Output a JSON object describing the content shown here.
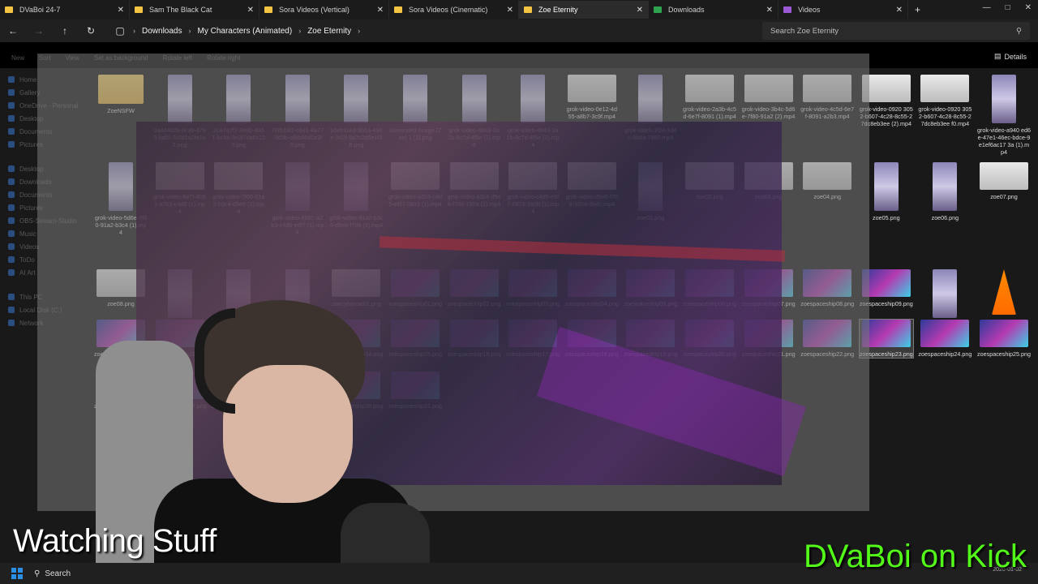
{
  "tabs": [
    {
      "label": "DVaBoi 24-7",
      "color": "#f4c542"
    },
    {
      "label": "Sam The Black Cat",
      "color": "#f4c542"
    },
    {
      "label": "Sora Videos (Vertical)",
      "color": "#f4c542"
    },
    {
      "label": "Sora Videos (Cinematic)",
      "color": "#f4c542"
    },
    {
      "label": "Zoe Eternity",
      "color": "#f4c542"
    },
    {
      "label": "Downloads",
      "color": "#2ea44f"
    },
    {
      "label": "Videos",
      "color": "#9b59d6"
    }
  ],
  "address": {
    "crumbs": [
      "Downloads",
      "My Characters (Animated)",
      "Zoe Eternity"
    ],
    "search_placeholder": "Search Zoe Eternity"
  },
  "toolbar": {
    "items": [
      "New",
      "Sort",
      "View",
      "Set as background",
      "Rotate left",
      "Rotate right"
    ],
    "details_label": "Details"
  },
  "sidebar": {
    "group1": [
      "Home",
      "Gallery",
      "OneDrive - Personal",
      "Desktop",
      "Documents",
      "Pictures"
    ],
    "group2": [
      "Desktop",
      "Downloads",
      "Documents",
      "Pictures",
      "OBS-Stream-Studio",
      "Music",
      "Videos",
      "ToDo",
      "AI Art"
    ],
    "group3": [
      "This PC",
      "Local Disk (C:)",
      "Network"
    ]
  },
  "files": {
    "row1": [
      {
        "name": "ZoeNSFW",
        "kind": "folder"
      },
      {
        "name": "0a4d4d2b-0c3b-4793-bdf0-7c0d1a2fe1a2.png",
        "kind": "portrait"
      },
      {
        "name": "2c47a7f2-3e8b-40d1-bc9a-8e3f7da6c123.png",
        "kind": "portrait"
      },
      {
        "name": "7f3b28f2-c6e1-4a77-9d3b-af8b46d1e2f0.png",
        "kind": "portrait"
      },
      {
        "name": "b0eb11e3-5b1a-4a8e-9d2f-8a7c2d5e1f38.png",
        "kind": "portrait"
      },
      {
        "name": "Generated Image (Zoe) 1 (1).png",
        "kind": "portrait"
      },
      {
        "name": "grok-video-4843-2a1b-8c7d-4f5e (1).mp4",
        "kind": "portrait"
      },
      {
        "name": "grok-video-4843-2a1b-8c7d-4f5e (2).mp4",
        "kind": "portrait"
      },
      {
        "name": "grok-video-0e12-4d55-a8b7-3c9f.mp4",
        "kind": "video"
      },
      {
        "name": "grok-video-1f2e-3d4c-5b6a-7980.mp4",
        "kind": "portrait"
      },
      {
        "name": "grok-video-2a3b-4c5d-6e7f-8091 (1).mp4",
        "kind": "video"
      },
      {
        "name": "grok-video-3b4c-5d6e-7f80-91a2 (2).mp4",
        "kind": "video"
      },
      {
        "name": "grok-video-4c5d-6e7f-8091-a2b3.mp4",
        "kind": "video"
      },
      {
        "name": "grok-video-0920 3052-b607-4c28-8c55-27dc8eb3ee (2).mp4",
        "kind": "video"
      },
      {
        "name": "grok-video-0920 3052-b607-4c28-8c55-27dc8eb3ee f0.mp4",
        "kind": "video"
      },
      {
        "name": "grok-video-a940 ed6e-47e1-46ec-bdce-9e1ef6ac17 3a (1).mp4",
        "kind": "portrait"
      }
    ],
    "row2": [
      {
        "name": "grok-video-5d6e-7f80-91a2-b3c4 (1).mp4",
        "kind": "portrait"
      },
      {
        "name": "grok-video-6e7f-8091-a2b3-c4d5 (1).mp4",
        "kind": "video"
      },
      {
        "name": "grok-video-7f80-91a2-b3c4-d5e6 (2).mp4",
        "kind": "video"
      },
      {
        "name": "grok-video-8091-a2b3-c4d5-e6f7 (1).mp4",
        "kind": "portrait"
      },
      {
        "name": "grok-video-91a2-b3c4-d5e6-f708 (3).mp4",
        "kind": "portrait"
      },
      {
        "name": "grok-video-a2b3-c4d5-e6f7-0819 (1).mp4",
        "kind": "video"
      },
      {
        "name": "grok-video-b3c4-d5e6-f708-192a (2).mp4",
        "kind": "video"
      },
      {
        "name": "grok-video-c4d5-e6f7-0819-2a3b (1).mp4",
        "kind": "video"
      },
      {
        "name": "grok-video-d5e6-f708-192a-3b4c.mp4",
        "kind": "video"
      },
      {
        "name": "zoe01.png",
        "kind": "portrait"
      },
      {
        "name": "zoe02.png",
        "kind": "video"
      },
      {
        "name": "zoe03.png",
        "kind": "video"
      },
      {
        "name": "zoe04.png",
        "kind": "video"
      },
      {
        "name": "zoe05.png",
        "kind": "portrait"
      },
      {
        "name": "zoe06.png",
        "kind": "portrait"
      },
      {
        "name": "zoe07.png",
        "kind": "video"
      }
    ],
    "row3": [
      {
        "name": "zoe08.png",
        "kind": "video"
      },
      {
        "name": "zoe09.png",
        "kind": "portrait"
      },
      {
        "name": "zoe10.png",
        "kind": "portrait"
      },
      {
        "name": "zoe11.png",
        "kind": "portrait"
      },
      {
        "name": "zoecybercat01.png",
        "kind": "video"
      },
      {
        "name": "zoespaceship01.png",
        "kind": "space"
      },
      {
        "name": "zoespaceship02.png",
        "kind": "space"
      },
      {
        "name": "zoespaceship03.png",
        "kind": "space"
      },
      {
        "name": "zoespaceship04.png",
        "kind": "space"
      },
      {
        "name": "zoespaceship05.png",
        "kind": "space"
      },
      {
        "name": "zoespaceship06.png",
        "kind": "space"
      },
      {
        "name": "zoespaceship07.png",
        "kind": "space"
      },
      {
        "name": "zoespaceship08.png",
        "kind": "space"
      },
      {
        "name": "zoespaceship09.png",
        "kind": "space"
      },
      {
        "name": "zoe01.png",
        "kind": "portrait"
      },
      {
        "name": "zoem1.mp4",
        "kind": "vlc"
      }
    ],
    "row4": [
      {
        "name": "zoespaceship10.png",
        "kind": "space"
      },
      {
        "name": "zoespaceship11.png",
        "kind": "space"
      },
      {
        "name": "zoespaceship12.png",
        "kind": "space"
      },
      {
        "name": "zoespaceship13.png",
        "kind": "space"
      },
      {
        "name": "zoespaceship14.png",
        "kind": "space"
      },
      {
        "name": "zoespaceship15.png",
        "kind": "space"
      },
      {
        "name": "zoespaceship16.png",
        "kind": "space"
      },
      {
        "name": "zoespaceship17.png",
        "kind": "space"
      },
      {
        "name": "zoespaceship18.png",
        "kind": "space"
      },
      {
        "name": "zoespaceship19.png",
        "kind": "space"
      },
      {
        "name": "zoespaceship20.png",
        "kind": "space"
      },
      {
        "name": "zoespaceship21.png",
        "kind": "space"
      },
      {
        "name": "zoespaceship22.png",
        "kind": "space"
      },
      {
        "name": "zoespaceship23.png",
        "kind": "space"
      },
      {
        "name": "zoespaceship24.png",
        "kind": "space"
      },
      {
        "name": "zoespaceship25.png",
        "kind": "space"
      }
    ],
    "row5": [
      {
        "name": "zoespaceship26.png",
        "kind": "space"
      },
      {
        "name": "zoespaceship27.png",
        "kind": "space"
      },
      {
        "name": "zoespaceship28.png",
        "kind": "space"
      },
      {
        "name": "zoespaceship29.png",
        "kind": "space"
      },
      {
        "name": "zoespaceship30.png",
        "kind": "space"
      },
      {
        "name": "zoespaceship31.png",
        "kind": "space"
      }
    ]
  },
  "taskbar": {
    "search_label": "Search",
    "clock_time": "",
    "clock_date": "2026-01-02"
  },
  "overlay": {
    "watching": "Watching Stuff",
    "kick": "DVaBoi on Kick"
  },
  "colors": {
    "kick_green": "#53fc18",
    "accent_blue": "#2b8fe6",
    "selected_border": "#7a7a7a"
  }
}
